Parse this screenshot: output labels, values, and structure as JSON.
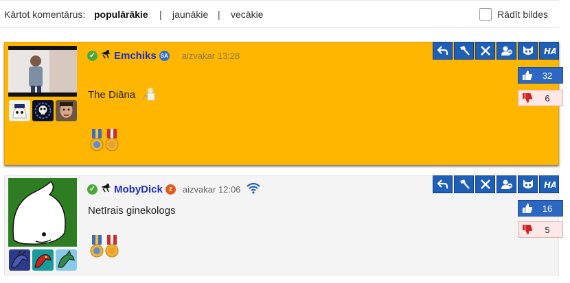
{
  "sort": {
    "label": "Kārtot komentārus:",
    "options": [
      "populārākie",
      "jaunākie",
      "vecākie"
    ],
    "separators": [
      "|",
      "|"
    ],
    "show_images_label": "Rādīt bildes"
  },
  "comments": [
    {
      "user": "Emchiks",
      "user_badge": "SA",
      "time": "aizvakar 13:28",
      "text": "The Diāna",
      "likes": "32",
      "dislikes": "6"
    },
    {
      "user": "MobyDick",
      "user_badge": "Z",
      "time": "aizvakar 12:06",
      "text": "Netīrais ginekologs",
      "likes": "16",
      "dislikes": "5"
    }
  ],
  "colors": {
    "highlight_bg": "#ffb600",
    "normal_bg": "#f4f4f4",
    "username": "#1d2fbf",
    "action_btn": "#1f5fb8"
  },
  "icons": {
    "actions": [
      "reply-icon",
      "ban-hammer-icon",
      "close-icon",
      "user-remove-icon",
      "ignore-icon",
      "ha-icon"
    ],
    "like": "thumbs-up-icon",
    "dislike": "thumbs-down-icon"
  }
}
